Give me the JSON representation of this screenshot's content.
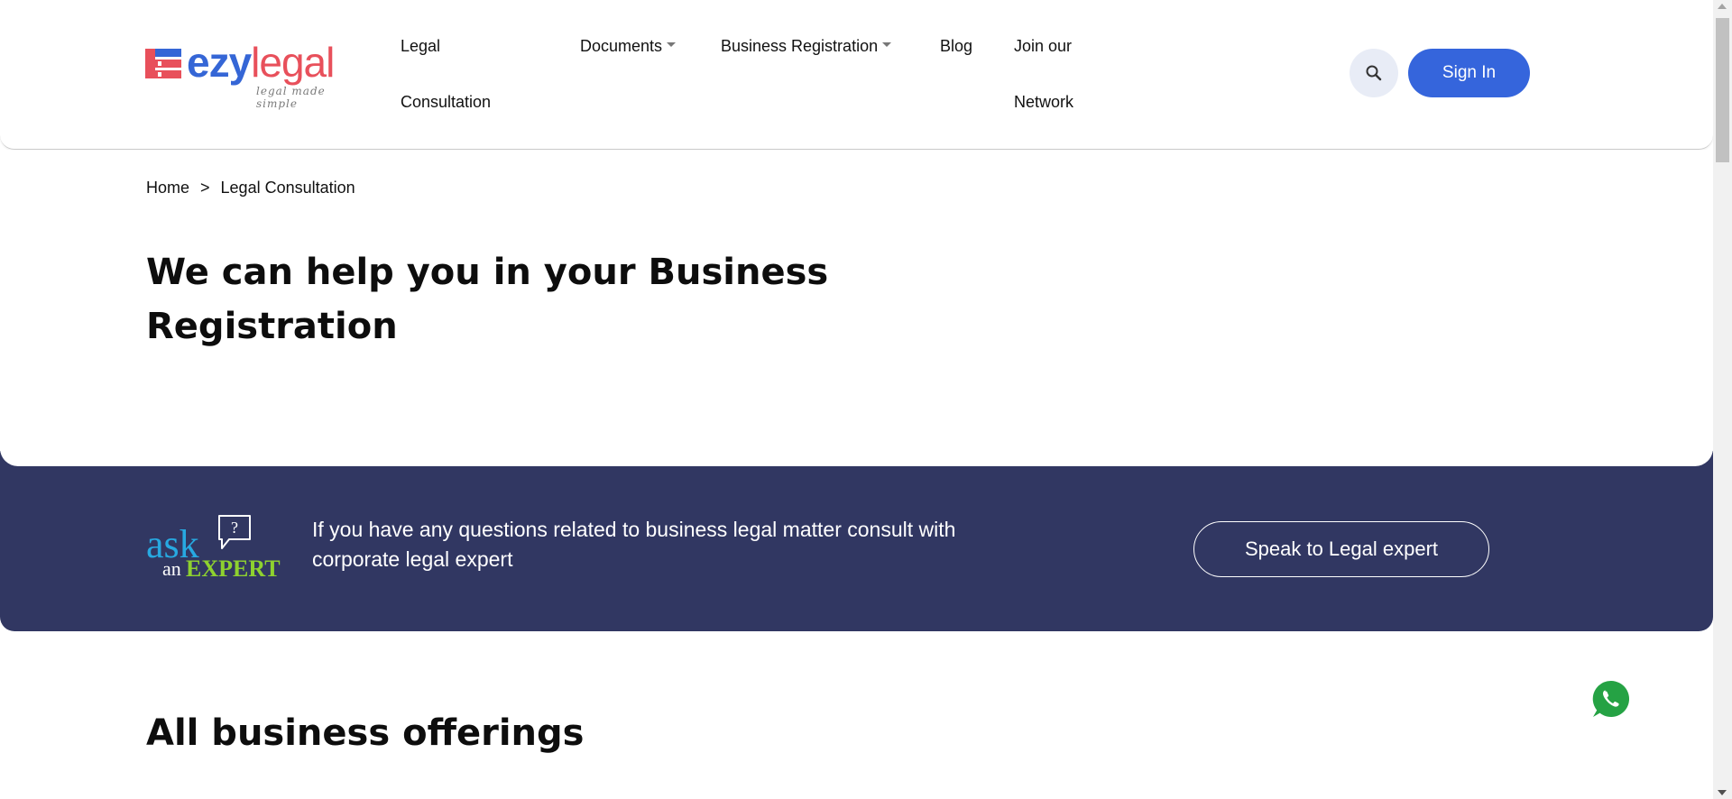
{
  "header": {
    "logo": {
      "brand_part1": "ezy",
      "brand_part2": "legal",
      "tagline": "legal made simple"
    },
    "nav": {
      "legal_consultation_line1": "Legal",
      "legal_consultation_line2": "Consultation",
      "documents": "Documents",
      "business_registration": "Business Registration",
      "blog": "Blog",
      "join_line1": "Join our",
      "join_line2": "Network"
    },
    "search_icon": "search-icon",
    "signin_label": "Sign In"
  },
  "breadcrumb": {
    "home": "Home",
    "separator": ">",
    "current": "Legal Consultation"
  },
  "hero": {
    "title_line1": "We can help you in your Business",
    "title_line2": "Registration"
  },
  "ask_expert": {
    "logo_ask": "ask",
    "logo_an": "an",
    "logo_expert": "EXPERT",
    "logo_question": "?",
    "text_line1": "If you have any questions related to business legal matter consult with",
    "text_line2": "corporate legal expert",
    "button_label": "Speak to Legal expert"
  },
  "offerings": {
    "title": "All business offerings"
  },
  "colors": {
    "brand_blue": "#3565dc",
    "brand_red": "#e8505b",
    "band_navy": "#313762",
    "whatsapp_green": "#25a244"
  }
}
